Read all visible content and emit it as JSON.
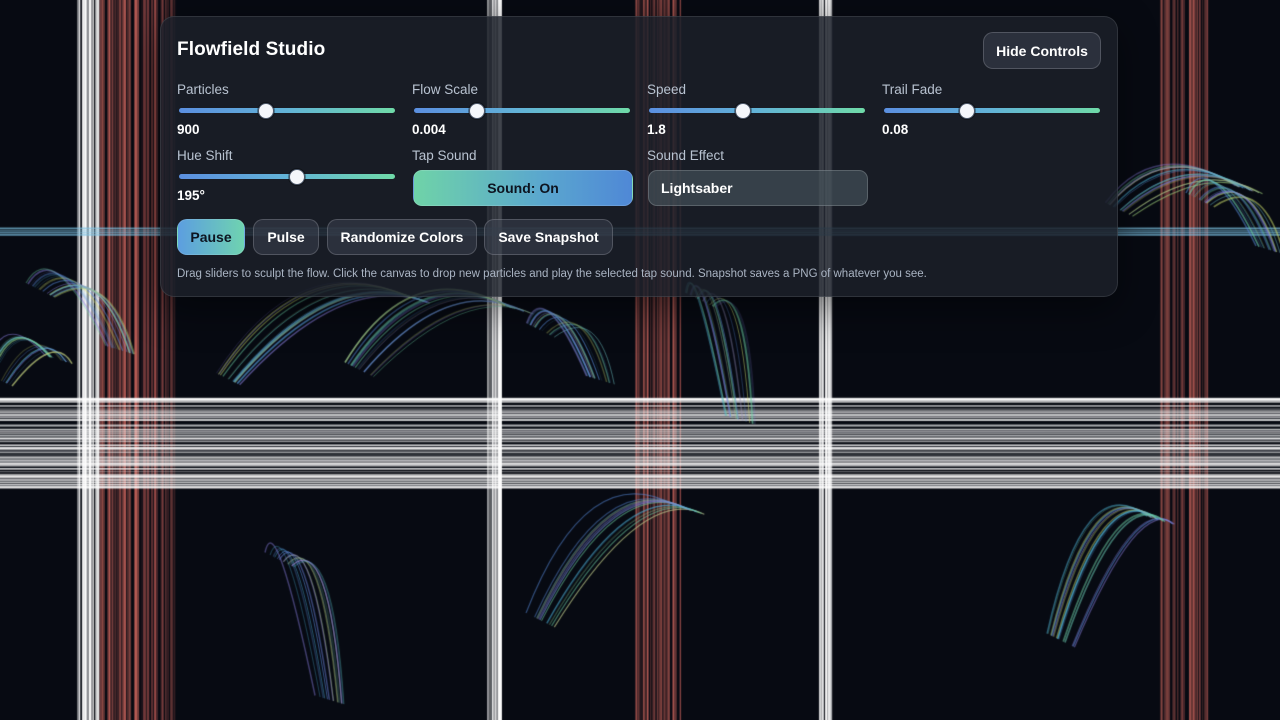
{
  "app": {
    "title": "Flowfield Studio",
    "hide_controls_label": "Hide Controls"
  },
  "controls": {
    "particles": {
      "label": "Particles",
      "value": "900",
      "level": 0.4
    },
    "flow_scale": {
      "label": "Flow Scale",
      "value": "0.004",
      "level": 0.29
    },
    "speed": {
      "label": "Speed",
      "value": "1.8",
      "level": 0.43
    },
    "trail_fade": {
      "label": "Trail Fade",
      "value": "0.08",
      "level": 0.38
    },
    "hue_shift": {
      "label": "Hue Shift",
      "value": "195°",
      "level": 0.54
    },
    "tap_sound": {
      "label": "Tap Sound",
      "button_label": "Sound: On"
    },
    "sound_effect": {
      "label": "Sound Effect",
      "selected": "Lightsaber"
    }
  },
  "actions": {
    "pause_label": "Pause",
    "pulse_label": "Pulse",
    "randomize_label": "Randomize Colors",
    "snapshot_label": "Save Snapshot"
  },
  "hint": "Drag sliders to sculpt the flow. Click the canvas to drop new particles and play the selected tap sound. Snapshot saves a PNG of whatever you see.",
  "colors": {
    "background": "#070a12",
    "accent_blue": "#5b8fe0",
    "accent_green": "#6fdaa8"
  }
}
